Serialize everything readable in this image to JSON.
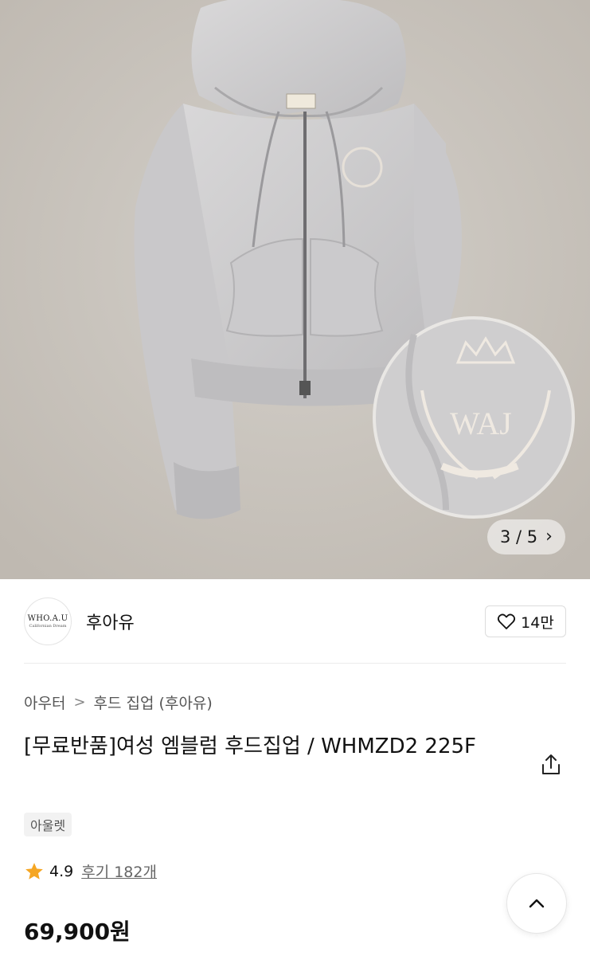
{
  "gallery": {
    "current": "3",
    "total": "5",
    "separator": "/",
    "counter_text": "3 / 5"
  },
  "brand": {
    "logo_text": "WHO.A.U",
    "logo_subtext": "Californian Dream",
    "name": "후아유",
    "like_count": "14만"
  },
  "breadcrumb": {
    "items": [
      "아우터",
      "후드 집업 (후아유)"
    ],
    "separator": ">"
  },
  "product": {
    "title": "[무료반품]여성 엠블럼 후드집업 / WHMZD2 225F",
    "tag": "아울렛",
    "rating": "4.9",
    "reviews": "후기 182개",
    "price": "69,900원"
  },
  "colors": {
    "star": "#f5a623",
    "text": "#111111",
    "muted": "#666666"
  },
  "icons": {
    "like": "heart-icon",
    "share": "share-icon",
    "next": "chevron-right-icon",
    "top": "chevron-up-icon",
    "star": "star-icon"
  }
}
